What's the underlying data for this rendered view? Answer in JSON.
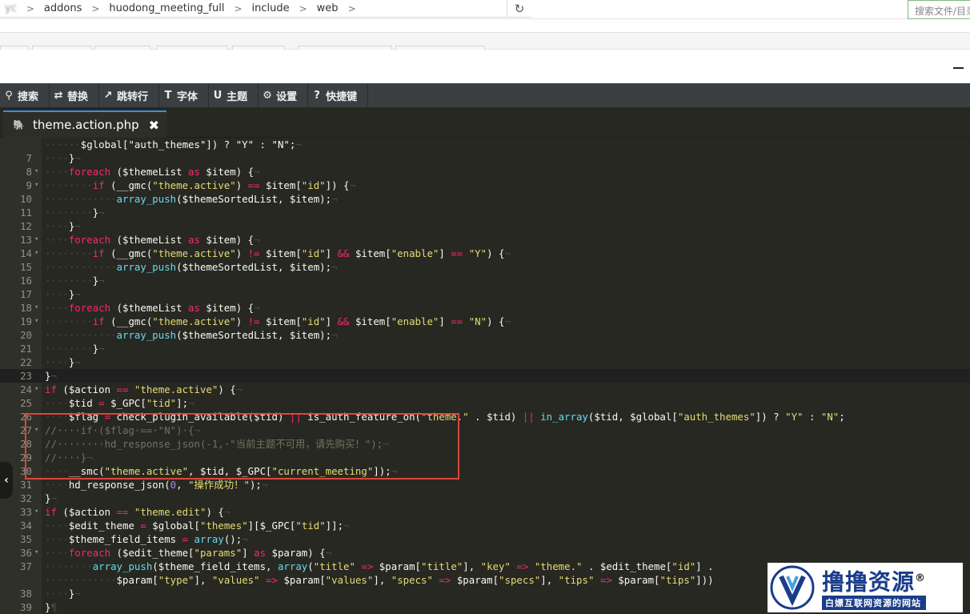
{
  "breadcrumb": {
    "items": [
      "yc",
      "addons",
      "huodong_meeting_full",
      "include",
      "web"
    ],
    "separator": ">"
  },
  "search": {
    "placeholder": "搜索文件/目录"
  },
  "toolbar": {
    "items": [
      {
        "icon": "search-icon",
        "label": "搜索"
      },
      {
        "icon": "replace-icon",
        "label": "替换"
      },
      {
        "icon": "jump-icon",
        "label": "跳转行"
      },
      {
        "icon": "font-icon",
        "label": "字体"
      },
      {
        "icon": "theme-icon",
        "label": "主题"
      },
      {
        "icon": "gear-icon",
        "label": "设置"
      },
      {
        "icon": "help-icon",
        "label": "快捷键"
      }
    ]
  },
  "file_tab": {
    "name": "theme.action.php",
    "close": "✖"
  },
  "watermark": {
    "title": "撸撸资源",
    "reg": "®",
    "subtitle": "白嫖互联网资源的网站"
  },
  "code": [
    {
      "n": "",
      "t": [
        [
          "ws",
          "······"
        ],
        [
          "pl",
          "$global[\"auth_themes\"]) ? \"Y\" : \"N\";"
        ],
        [
          "ws",
          "¬"
        ]
      ]
    },
    {
      "n": "7",
      "t": [
        [
          "ws",
          "····"
        ],
        [
          "pl",
          "}"
        ],
        [
          "ws",
          "¬"
        ]
      ]
    },
    {
      "n": "8",
      "f": "▾",
      "t": [
        [
          "ws",
          "····"
        ],
        [
          "kw",
          "foreach"
        ],
        [
          "pl",
          " ($themeList "
        ],
        [
          "kw",
          "as"
        ],
        [
          "pl",
          " $item) {"
        ],
        [
          "ws",
          "¬"
        ]
      ]
    },
    {
      "n": "9",
      "f": "▾",
      "t": [
        [
          "ws",
          "········"
        ],
        [
          "kw",
          "if"
        ],
        [
          "pl",
          " (__gmc("
        ],
        [
          "st",
          "\"theme.active\""
        ],
        [
          "pl",
          ") "
        ],
        [
          "kw",
          "=="
        ],
        [
          "pl",
          " $item["
        ],
        [
          "st",
          "\"id\""
        ],
        [
          "pl",
          "]) {"
        ],
        [
          "ws",
          "¬"
        ]
      ]
    },
    {
      "n": "10",
      "t": [
        [
          "ws",
          "············"
        ],
        [
          "bl",
          "array_push"
        ],
        [
          "pl",
          "($themeSortedList, $item);"
        ],
        [
          "ws",
          "¬"
        ]
      ]
    },
    {
      "n": "11",
      "t": [
        [
          "ws",
          "········"
        ],
        [
          "pl",
          "}"
        ],
        [
          "ws",
          "¬"
        ]
      ]
    },
    {
      "n": "12",
      "t": [
        [
          "ws",
          "····"
        ],
        [
          "pl",
          "}"
        ],
        [
          "ws",
          "¬"
        ]
      ]
    },
    {
      "n": "13",
      "f": "▾",
      "t": [
        [
          "ws",
          "····"
        ],
        [
          "kw",
          "foreach"
        ],
        [
          "pl",
          " ($themeList "
        ],
        [
          "kw",
          "as"
        ],
        [
          "pl",
          " $item) {"
        ],
        [
          "ws",
          "¬"
        ]
      ]
    },
    {
      "n": "14",
      "f": "▾",
      "t": [
        [
          "ws",
          "········"
        ],
        [
          "kw",
          "if"
        ],
        [
          "pl",
          " (__gmc("
        ],
        [
          "st",
          "\"theme.active\""
        ],
        [
          "pl",
          ") "
        ],
        [
          "kw",
          "!="
        ],
        [
          "pl",
          " $item["
        ],
        [
          "st",
          "\"id\""
        ],
        [
          "pl",
          "] "
        ],
        [
          "kw",
          "&&"
        ],
        [
          "pl",
          " $item["
        ],
        [
          "st",
          "\"enable\""
        ],
        [
          "pl",
          "] "
        ],
        [
          "kw",
          "=="
        ],
        [
          "pl",
          " "
        ],
        [
          "st",
          "\"Y\""
        ],
        [
          "pl",
          ") {"
        ],
        [
          "ws",
          "¬"
        ]
      ]
    },
    {
      "n": "15",
      "t": [
        [
          "ws",
          "············"
        ],
        [
          "bl",
          "array_push"
        ],
        [
          "pl",
          "($themeSortedList, $item);"
        ],
        [
          "ws",
          "¬"
        ]
      ]
    },
    {
      "n": "16",
      "t": [
        [
          "ws",
          "········"
        ],
        [
          "pl",
          "}"
        ],
        [
          "ws",
          "¬"
        ]
      ]
    },
    {
      "n": "17",
      "t": [
        [
          "ws",
          "····"
        ],
        [
          "pl",
          "}"
        ],
        [
          "ws",
          "¬"
        ]
      ]
    },
    {
      "n": "18",
      "f": "▾",
      "t": [
        [
          "ws",
          "····"
        ],
        [
          "kw",
          "foreach"
        ],
        [
          "pl",
          " ($themeList "
        ],
        [
          "kw",
          "as"
        ],
        [
          "pl",
          " $item) {"
        ],
        [
          "ws",
          "¬"
        ]
      ]
    },
    {
      "n": "19",
      "f": "▾",
      "t": [
        [
          "ws",
          "········"
        ],
        [
          "kw",
          "if"
        ],
        [
          "pl",
          " (__gmc("
        ],
        [
          "st",
          "\"theme.active\""
        ],
        [
          "pl",
          ") "
        ],
        [
          "kw",
          "!="
        ],
        [
          "pl",
          " $item["
        ],
        [
          "st",
          "\"id\""
        ],
        [
          "pl",
          "] "
        ],
        [
          "kw",
          "&&"
        ],
        [
          "pl",
          " $item["
        ],
        [
          "st",
          "\"enable\""
        ],
        [
          "pl",
          "] "
        ],
        [
          "kw",
          "=="
        ],
        [
          "pl",
          " "
        ],
        [
          "st",
          "\"N\""
        ],
        [
          "pl",
          ") {"
        ],
        [
          "ws",
          "¬"
        ]
      ]
    },
    {
      "n": "20",
      "t": [
        [
          "ws",
          "············"
        ],
        [
          "bl",
          "array_push"
        ],
        [
          "pl",
          "($themeSortedList, $item);"
        ],
        [
          "ws",
          "¬"
        ]
      ]
    },
    {
      "n": "21",
      "t": [
        [
          "ws",
          "········"
        ],
        [
          "pl",
          "}"
        ],
        [
          "ws",
          "¬"
        ]
      ]
    },
    {
      "n": "22",
      "t": [
        [
          "ws",
          "····"
        ],
        [
          "pl",
          "}"
        ],
        [
          "ws",
          "¬"
        ]
      ]
    },
    {
      "n": "23",
      "a": true,
      "t": [
        [
          "pl",
          "}"
        ],
        [
          "ws",
          "¬"
        ]
      ]
    },
    {
      "n": "24",
      "f": "▾",
      "t": [
        [
          "kw",
          "if"
        ],
        [
          "pl",
          " ($action "
        ],
        [
          "kw",
          "=="
        ],
        [
          "pl",
          " "
        ],
        [
          "st",
          "\"theme.active\""
        ],
        [
          "pl",
          ") {"
        ],
        [
          "ws",
          "¬"
        ]
      ]
    },
    {
      "n": "25",
      "t": [
        [
          "ws",
          "····"
        ],
        [
          "pl",
          "$tid "
        ],
        [
          "kw",
          "="
        ],
        [
          "pl",
          " $_GPC["
        ],
        [
          "st",
          "\"tid\""
        ],
        [
          "pl",
          "];"
        ],
        [
          "ws",
          "¬"
        ]
      ]
    },
    {
      "n": "26",
      "t": [
        [
          "ws",
          "····"
        ],
        [
          "pl",
          "$flag "
        ],
        [
          "kw",
          "="
        ],
        [
          "pl",
          " check_plugin_available($tid) "
        ],
        [
          "kw",
          "||"
        ],
        [
          "pl",
          " is_auth_feature_on("
        ],
        [
          "st",
          "\"theme.\""
        ],
        [
          "pl",
          " . $tid) "
        ],
        [
          "kw",
          "||"
        ],
        [
          "pl",
          " "
        ],
        [
          "bl",
          "in_array"
        ],
        [
          "pl",
          "($tid, $global["
        ],
        [
          "st",
          "\"auth_themes\""
        ],
        [
          "pl",
          "]) ? "
        ],
        [
          "st",
          "\"Y\""
        ],
        [
          "pl",
          " : "
        ],
        [
          "st",
          "\"N\""
        ],
        [
          "pl",
          ";"
        ]
      ]
    },
    {
      "n": "27",
      "f": "▾",
      "t": [
        [
          "cm",
          "//····if·($flag·==·\"N\")·{"
        ],
        [
          "ws",
          "¬"
        ]
      ]
    },
    {
      "n": "28",
      "t": [
        [
          "cm",
          "//········hd_response_json(-1,·\"当前主题不可用，请先购买！\");"
        ],
        [
          "ws",
          "¬"
        ]
      ]
    },
    {
      "n": "29",
      "t": [
        [
          "cm",
          "//····}"
        ],
        [
          "ws",
          "¬"
        ]
      ]
    },
    {
      "n": "30",
      "t": [
        [
          "ws",
          "····"
        ],
        [
          "pl",
          "__smc("
        ],
        [
          "st",
          "\"theme.active\""
        ],
        [
          "pl",
          ", $tid, $_GPC["
        ],
        [
          "st",
          "\"current_meeting\""
        ],
        [
          "pl",
          "]);"
        ],
        [
          "ws",
          "¬"
        ]
      ]
    },
    {
      "n": "31",
      "t": [
        [
          "ws",
          "····"
        ],
        [
          "pl",
          "hd_response_json("
        ],
        [
          "nu",
          "0"
        ],
        [
          "pl",
          ", "
        ],
        [
          "st",
          "\"操作成功！\""
        ],
        [
          "pl",
          ");"
        ],
        [
          "ws",
          "¬"
        ]
      ]
    },
    {
      "n": "32",
      "t": [
        [
          "pl",
          "}"
        ],
        [
          "ws",
          "¬"
        ]
      ]
    },
    {
      "n": "33",
      "f": "▾",
      "t": [
        [
          "kw",
          "if"
        ],
        [
          "pl",
          " ($action "
        ],
        [
          "kw",
          "=="
        ],
        [
          "pl",
          " "
        ],
        [
          "st",
          "\"theme.edit\""
        ],
        [
          "pl",
          ") {"
        ],
        [
          "ws",
          "¬"
        ]
      ]
    },
    {
      "n": "34",
      "t": [
        [
          "ws",
          "····"
        ],
        [
          "pl",
          "$edit_theme "
        ],
        [
          "kw",
          "="
        ],
        [
          "pl",
          " $global["
        ],
        [
          "st",
          "\"themes\""
        ],
        [
          "pl",
          "][$_GPC["
        ],
        [
          "st",
          "\"tid\""
        ],
        [
          "pl",
          "]];"
        ],
        [
          "ws",
          "¬"
        ]
      ]
    },
    {
      "n": "35",
      "t": [
        [
          "ws",
          "····"
        ],
        [
          "pl",
          "$theme_field_items "
        ],
        [
          "kw",
          "="
        ],
        [
          "pl",
          " "
        ],
        [
          "bl",
          "array"
        ],
        [
          "pl",
          "();"
        ],
        [
          "ws",
          "¬"
        ]
      ]
    },
    {
      "n": "36",
      "f": "▾",
      "t": [
        [
          "ws",
          "····"
        ],
        [
          "kw",
          "foreach"
        ],
        [
          "pl",
          " ($edit_theme["
        ],
        [
          "st",
          "\"params\""
        ],
        [
          "pl",
          "] "
        ],
        [
          "kw",
          "as"
        ],
        [
          "pl",
          " $param) {"
        ],
        [
          "ws",
          "¬"
        ]
      ]
    },
    {
      "n": "37",
      "t": [
        [
          "ws",
          "········"
        ],
        [
          "bl",
          "array_push"
        ],
        [
          "pl",
          "($theme_field_items, "
        ],
        [
          "bl",
          "array"
        ],
        [
          "pl",
          "("
        ],
        [
          "st",
          "\"title\""
        ],
        [
          "pl",
          " "
        ],
        [
          "kw",
          "=>"
        ],
        [
          "pl",
          " $param["
        ],
        [
          "st",
          "\"title\""
        ],
        [
          "pl",
          "], "
        ],
        [
          "st",
          "\"key\""
        ],
        [
          "pl",
          " "
        ],
        [
          "kw",
          "=>"
        ],
        [
          "pl",
          " "
        ],
        [
          "st",
          "\"theme.\""
        ],
        [
          "pl",
          " . $edit_theme["
        ],
        [
          "st",
          "\"id\""
        ],
        [
          "pl",
          "] ."
        ]
      ]
    },
    {
      "n": "",
      "t": [
        [
          "ws",
          "············"
        ],
        [
          "pl",
          "$param["
        ],
        [
          "st",
          "\"type\""
        ],
        [
          "pl",
          "], "
        ],
        [
          "st",
          "\"values\""
        ],
        [
          "pl",
          " "
        ],
        [
          "kw",
          "=>"
        ],
        [
          "pl",
          " $param["
        ],
        [
          "st",
          "\"values\""
        ],
        [
          "pl",
          "], "
        ],
        [
          "st",
          "\"specs\""
        ],
        [
          "pl",
          " "
        ],
        [
          "kw",
          "=>"
        ],
        [
          "pl",
          " $param["
        ],
        [
          "st",
          "\"specs\""
        ],
        [
          "pl",
          "], "
        ],
        [
          "st",
          "\"tips\""
        ],
        [
          "pl",
          " "
        ],
        [
          "kw",
          "=>"
        ],
        [
          "pl",
          " $param["
        ],
        [
          "st",
          "\"tips\""
        ],
        [
          "pl",
          "]))"
        ]
      ]
    },
    {
      "n": "38",
      "t": [
        [
          "ws",
          "····"
        ],
        [
          "pl",
          "}"
        ],
        [
          "ws",
          "¬"
        ]
      ]
    },
    {
      "n": "39",
      "t": [
        [
          "pl",
          "}"
        ],
        [
          "ws",
          "¶"
        ]
      ]
    }
  ]
}
